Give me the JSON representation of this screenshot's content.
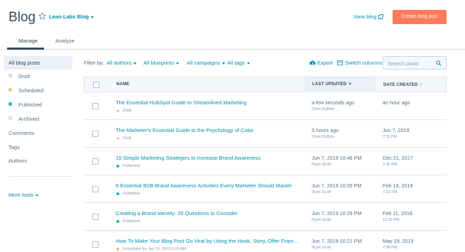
{
  "header": {
    "title": "Blog",
    "blog_name": "Lean-Labs Blog",
    "view_blog": "View blog",
    "create_button": "Create blog post"
  },
  "tabs": [
    {
      "label": "Manage",
      "active": true
    },
    {
      "label": "Analyze",
      "active": false
    }
  ],
  "sidebar": {
    "all_posts": "All blog posts",
    "statuses": [
      {
        "label": "Draft",
        "color": "#cbd6e2"
      },
      {
        "label": "Scheduled",
        "color": "#f5c26b"
      },
      {
        "label": "Published",
        "color": "#00bda5"
      },
      {
        "label": "Archived",
        "color": "#cbd6e2"
      }
    ],
    "items": [
      "Comments",
      "Tags",
      "Authors"
    ],
    "more_tools": "More tools"
  },
  "filters": {
    "label": "Filter by:",
    "authors": "All authors",
    "blueprints": "All blueprints",
    "campaigns": "All campaigns",
    "tags": "All tags",
    "export": "Export",
    "switch_columns": "Switch columns",
    "search_placeholder": "Search posts"
  },
  "table": {
    "columns": {
      "name": "NAME",
      "last_updated": "LAST UPDATED",
      "date_created": "DATE CREATED"
    },
    "rows": [
      {
        "title": "The Essential HubSpot Guide to Streamlined Marketing",
        "status": "Draft",
        "status_color": "#cbd6e2",
        "updated": "a few seconds ago",
        "updated_by": "Chris DuBois",
        "created": "an hour ago",
        "created_time": ""
      },
      {
        "title": "The Marketer's Essential Guide to the Psychology of Color",
        "status": "Draft",
        "status_color": "#cbd6e2",
        "updated": "5 hours ago",
        "updated_by": "Chris DuBois",
        "created": "Jun 7, 2019",
        "created_time": "7:11 PM"
      },
      {
        "title": "15 Simple Marketing Strategies to Increase Brand Awareness",
        "status": "Published",
        "status_color": "#00bda5",
        "updated": "Jun 7, 2019 10:46 PM",
        "updated_by": "Ryan Scott",
        "created": "Dec 21, 2017",
        "created_time": "2:35 PM"
      },
      {
        "title": "8 Essential B2B Brand Awareness Activities Every Marketer Should Master",
        "status": "Published",
        "status_color": "#00bda5",
        "updated": "Jun 7, 2019 10:35 PM",
        "updated_by": "Ryan Scott",
        "created": "Feb 19, 2018",
        "created_time": "7:22 PM"
      },
      {
        "title": "Creating a Brand Identity: 20 Questions to Consider",
        "status": "Published",
        "status_color": "#00bda5",
        "updated": "Jun 7, 2019 10:29 PM",
        "updated_by": "Ryan Scott",
        "created": "Feb 11, 2016",
        "created_time": "12:15 PM"
      },
      {
        "title": "How To Make Your Blog Post Go Viral by Using the Hook, Story, Offer Framew...",
        "status": "Scheduled for Jun 13, 2019 9:16 AM",
        "status_color": "#f5c26b",
        "updated": "Jun 7, 2019 10:21 PM",
        "updated_by": "Ryan Scott",
        "created": "May 29, 2019",
        "created_time": "7:38 PM"
      }
    ]
  }
}
